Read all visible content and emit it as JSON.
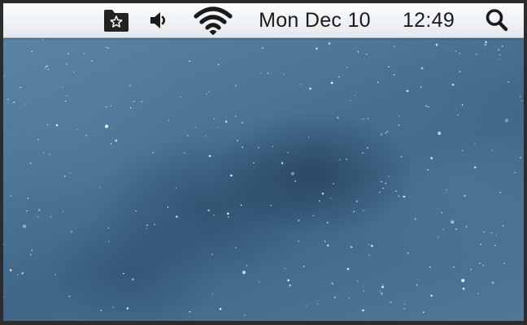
{
  "desktop": {
    "wallpaper": "starfield-galaxy",
    "colors": {
      "menubar_background": "#eef1f4",
      "menubar_text": "#1a1a1a",
      "wallpaper_primary": "#4d7696",
      "wallpaper_dark": "#2a4a6a"
    }
  },
  "menubar": {
    "status_items": [
      {
        "name": "favorites-folder-icon"
      },
      {
        "name": "volume-icon"
      },
      {
        "name": "wifi-icon"
      }
    ],
    "date": "Mon Dec 10",
    "time": "12:49",
    "spotlight_icon": "search-icon"
  }
}
